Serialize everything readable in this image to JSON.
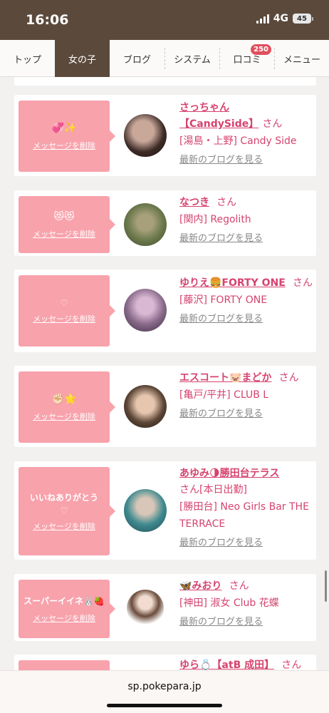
{
  "status": {
    "time": "16:06",
    "network": "4G",
    "battery": "45"
  },
  "nav": {
    "items": [
      {
        "label": "トップ"
      },
      {
        "label": "女の子"
      },
      {
        "label": "ブログ"
      },
      {
        "label": "システム"
      },
      {
        "label": "口コミ",
        "badge": "250"
      },
      {
        "label": "メニュー"
      }
    ],
    "active": "女の子"
  },
  "cards": [
    {
      "message": "💞✨",
      "delete_label": "メッセージを削除",
      "name": "さっちゃん【CandySide】",
      "san": "さん",
      "shop": "[湯島・上野] Candy Side",
      "blog": "最新のブログを見る"
    },
    {
      "message": "😻😻",
      "delete_label": "メッセージを削除",
      "name": "なつき",
      "san": "さん",
      "shop": "[関内] Regolith",
      "blog": "最新のブログを見る"
    },
    {
      "message": "♡",
      "delete_label": "メッセージを削除",
      "name": "ゆりえ🍔FORTY ONE",
      "san": "さん",
      "shop": "[藤沢] FORTY ONE",
      "blog": "最新のブログを見る"
    },
    {
      "message": "✊🏻🌟",
      "delete_label": "メッセージを削除",
      "name": "エスコート🐷まどか",
      "san": "さん",
      "shop": "[亀戸/平井] CLUB L",
      "blog": "最新のブログを見る"
    },
    {
      "message": "いいねありがとう",
      "heart": "♡",
      "delete_label": "メッセージを削除",
      "name": "あゆみ🌗勝田台テラス",
      "san": "さん[本日出勤]",
      "shop": "[勝田台] Neo Girls Bar THE TERRACE",
      "blog": "最新のブログを見る"
    },
    {
      "message": "スーパーイイネ🐰🍓",
      "delete_label": "メッセージを削除",
      "name": "🦋みおり",
      "san": "さん",
      "shop": "[神田] 淑女 Club 花蝶",
      "blog": "最新のブログを見る"
    },
    {
      "name": "ゆら💍【atB 成田】",
      "san": "さん"
    }
  ],
  "url": "sp.pokepara.jp"
}
